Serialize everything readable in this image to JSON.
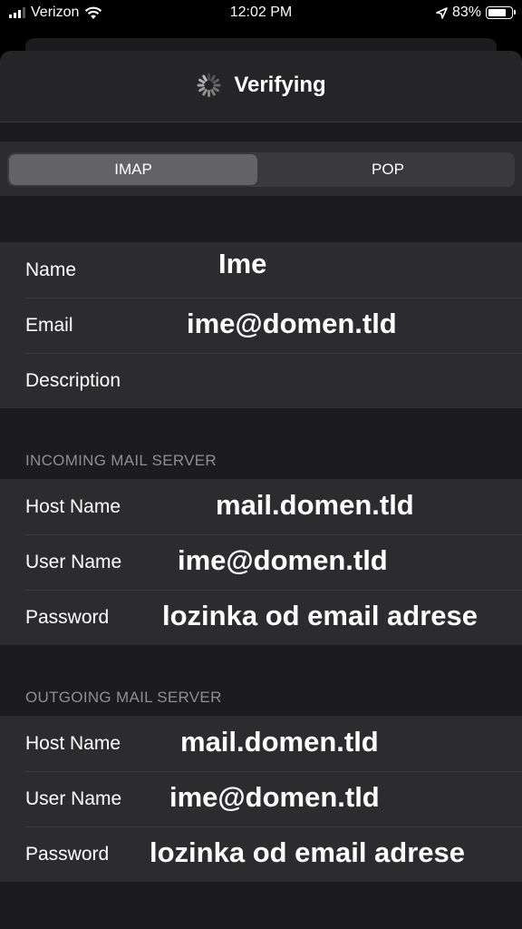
{
  "status_bar": {
    "carrier": "Verizon",
    "time": "12:02 PM",
    "battery_percent": "83%",
    "battery_level": 0.83,
    "icons": [
      "cellular-signal-icon",
      "wifi-icon",
      "location-arrow-icon",
      "battery-icon"
    ]
  },
  "nav": {
    "title": "Verifying",
    "spinner_icon": "activity-spinner-icon"
  },
  "segmented": {
    "options": [
      "IMAP",
      "POP"
    ],
    "selected": "IMAP"
  },
  "account": {
    "name_label": "Name",
    "name_value": "Ime",
    "email_label": "Email",
    "email_value": "ime@domen.tld",
    "description_label": "Description",
    "description_value": ""
  },
  "incoming": {
    "header": "INCOMING MAIL SERVER",
    "host_label": "Host Name",
    "host_value": "mail.domen.tld",
    "user_label": "User Name",
    "user_value": "ime@domen.tld",
    "password_label": "Password",
    "password_value": "lozinka od email adrese"
  },
  "outgoing": {
    "header": "OUTGOING MAIL SERVER",
    "host_label": "Host Name",
    "host_value": "mail.domen.tld",
    "user_label": "User Name",
    "user_value": "ime@domen.tld",
    "password_label": "Password",
    "password_value": "lozinka od email adrese"
  },
  "colors": {
    "background": "#1c1c1e",
    "cell": "#2c2c2e",
    "segment_active": "#636366",
    "secondary_text": "#8e8e93"
  }
}
